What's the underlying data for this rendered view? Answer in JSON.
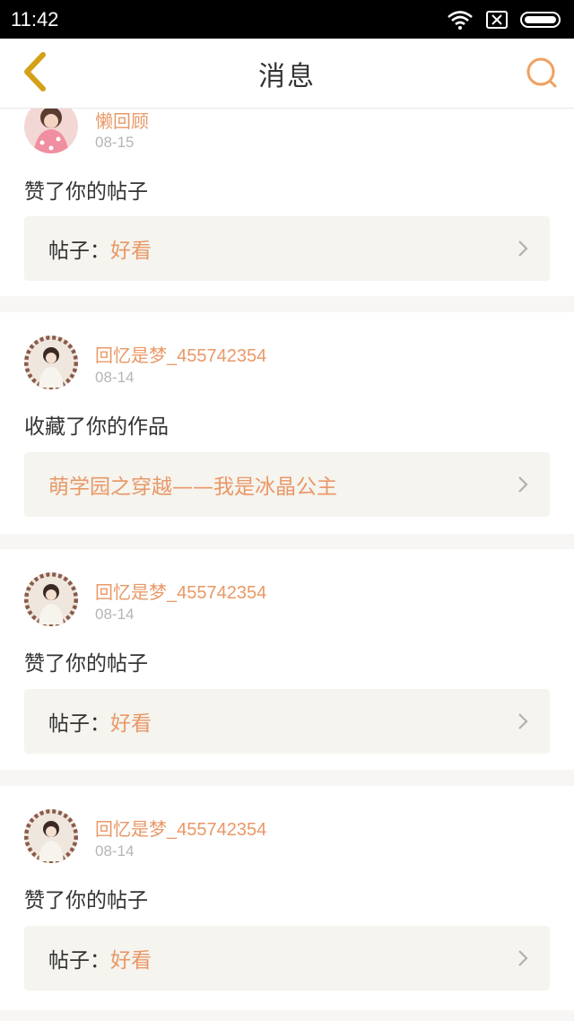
{
  "status_bar": {
    "time": "11:42",
    "icons": [
      "wifi-icon",
      "sim-icon",
      "battery-icon"
    ]
  },
  "header": {
    "title": "消息",
    "back_icon": "chevron-left-icon",
    "search_icon": "search-icon"
  },
  "colors": {
    "accent": "#e99867",
    "back_icon": "#d4a017",
    "search_icon": "#f0a060",
    "text": "#333333",
    "muted": "#b5b5b5",
    "ref_bg": "#f5f4ef"
  },
  "messages": [
    {
      "username": "懒回顾",
      "date": "08-15",
      "action": "赞了你的帖子",
      "ref_prefix": "帖子：",
      "ref_value": "好看"
    },
    {
      "username": "回忆是梦_455742354",
      "date": "08-14",
      "action": "收藏了你的作品",
      "ref_prefix": "",
      "ref_value": "萌学园之穿越——我是冰晶公主"
    },
    {
      "username": "回忆是梦_455742354",
      "date": "08-14",
      "action": "赞了你的帖子",
      "ref_prefix": "帖子：",
      "ref_value": "好看"
    },
    {
      "username": "回忆是梦_455742354",
      "date": "08-14",
      "action": "赞了你的帖子",
      "ref_prefix": "帖子：",
      "ref_value": "好看"
    }
  ]
}
